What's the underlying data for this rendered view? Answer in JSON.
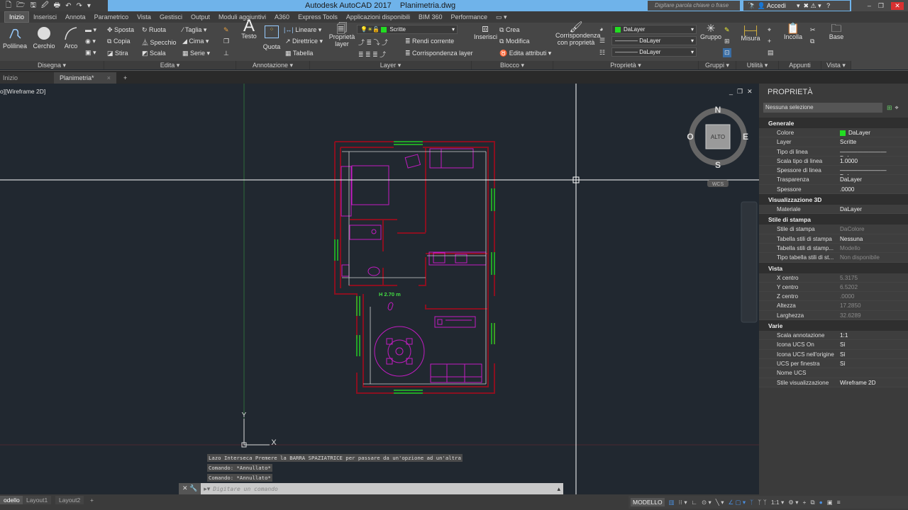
{
  "window": {
    "title": "Autodesk AutoCAD 2017    Planimetria.dwg",
    "search_placeholder": "Digitare parola chiave o frase",
    "account": "Accedi",
    "min": "–",
    "max": "❐",
    "close": "✕"
  },
  "quick_access": [
    "🗋",
    "🗁",
    "🖫",
    "🖉",
    "🖶",
    "↶",
    "↷",
    "▾"
  ],
  "menu_tabs": [
    "Inizio",
    "Inserisci",
    "Annota",
    "Parametrico",
    "Vista",
    "Gestisci",
    "Output",
    "Moduli aggiuntivi",
    "A360",
    "Express Tools",
    "Applicazioni disponibili",
    "BIM 360",
    "Performance",
    "▭ ▾"
  ],
  "ribbon": {
    "disegna": {
      "title": "Disegna ▾",
      "polilinea": "Polilinea",
      "cerchio": "Cerchio",
      "arco": "Arco"
    },
    "edita": {
      "title": "Edita ▾",
      "sposta": "Sposta",
      "copia": "Copia",
      "stira": "Stira",
      "ruota": "Ruota",
      "specchio": "Specchio",
      "scala": "Scala",
      "taglia": "Taglia ▾",
      "cima": "Cima ▾",
      "serie": "Serie ▾"
    },
    "annotazione": {
      "title": "Annotazione ▾",
      "testo": "Testo",
      "quota": "Quota",
      "lineare": "Lineare ▾",
      "direttrice": "Direttrice ▾",
      "tabella": "Tabella"
    },
    "layer": {
      "title": "Layer ▾",
      "proprieta_layer": "Proprietà layer",
      "current_layer": "Scritte",
      "rendi_corrente": "Rendi corrente",
      "corrispondenza": "Corrispondenza layer"
    },
    "blocco": {
      "title": "Blocco ▾",
      "inserisci": "Inserisci",
      "crea": "Crea",
      "modifica": "Modifica",
      "edita_attributi": "Edita attributi ▾"
    },
    "proprieta": {
      "title": "Proprietà ▾",
      "corrispondenza": "Corrispondenza con proprietà",
      "color": "DaLayer",
      "linetype": "DaLayer",
      "lineweight": "DaLayer"
    },
    "gruppi": {
      "title": "Gruppi ▾",
      "gruppo": "Gruppo"
    },
    "utilita": {
      "title": "Utilità ▾",
      "misura": "Misura"
    },
    "appunti": {
      "title": "Appunti",
      "incolla": "Incolla"
    },
    "vista": {
      "title": "Vista ▾",
      "base": "Base"
    }
  },
  "file_tabs": {
    "start": "Inizio",
    "active": "Planimetria*",
    "close": "×",
    "add": "+"
  },
  "viewport": {
    "label": "o][Wireframe 2D]",
    "controls": [
      "_",
      "❐",
      "✕"
    ],
    "viewcube": {
      "n": "N",
      "s": "S",
      "e": "E",
      "w": "O",
      "face": "ALTO",
      "ucs": "WCS"
    },
    "ucs_x": "X",
    "ucs_y": "Y",
    "height_label": "H 2.70 m"
  },
  "properties": {
    "title": "PROPRIETÀ",
    "selection": "Nessuna selezione",
    "sections": [
      {
        "name": "Generale",
        "rows": [
          [
            "Colore",
            "DaLayer"
          ],
          [
            "Layer",
            "Scritte"
          ],
          [
            "Tipo di linea",
            "DaLayer"
          ],
          [
            "Scala tipo di linea",
            "1.0000"
          ],
          [
            "Spessore di linea",
            "DaLayer"
          ],
          [
            "Trasparenza",
            "DaLayer"
          ],
          [
            "Spessore",
            ".0000"
          ]
        ]
      },
      {
        "name": "Visualizzazione 3D",
        "rows": [
          [
            "Materiale",
            "DaLayer"
          ]
        ]
      },
      {
        "name": "Stile di stampa",
        "rows": [
          [
            "Stile di stampa",
            "DaColore"
          ],
          [
            "Tabella stili di stampa",
            "Nessuna"
          ],
          [
            "Tabella stili di stamp...",
            "Modello"
          ],
          [
            "Tipo tabella stili di st...",
            "Non disponibile"
          ]
        ]
      },
      {
        "name": "Vista",
        "rows": [
          [
            "X centro",
            "5.3175"
          ],
          [
            "Y centro",
            "6.5202"
          ],
          [
            "Z centro",
            ".0000"
          ],
          [
            "Altezza",
            "17.2850"
          ],
          [
            "Larghezza",
            "32.6289"
          ]
        ]
      },
      {
        "name": "Varie",
        "rows": [
          [
            "Scala annotazione",
            "1:1"
          ],
          [
            "Icona UCS On",
            "Sì"
          ],
          [
            "Icona UCS nell'origine",
            "Sì"
          ],
          [
            "UCS per finestra",
            "Sì"
          ],
          [
            "Nome UCS",
            ""
          ],
          [
            "Stile visualizzazione",
            "Wireframe 2D"
          ]
        ]
      }
    ]
  },
  "command": {
    "history": [
      "Lazo Interseca  Premere la BARRA SPAZIATRICE per passare da un'opzione ad un'altra",
      "Comando: *Annullato*",
      "Comando: *Annullato*"
    ],
    "placeholder": "Digitare un comando"
  },
  "layout_tabs": [
    "odello",
    "Layout1",
    "Layout2",
    "+"
  ],
  "statusbar": {
    "model": "MODELLO",
    "scale": "1:1 ▾"
  },
  "colors": {
    "wall": "#8b1020",
    "furniture": "#c21cc2",
    "window": "#22cc22",
    "dim": "#d0d0d0",
    "accent": "#6fb3ea"
  }
}
